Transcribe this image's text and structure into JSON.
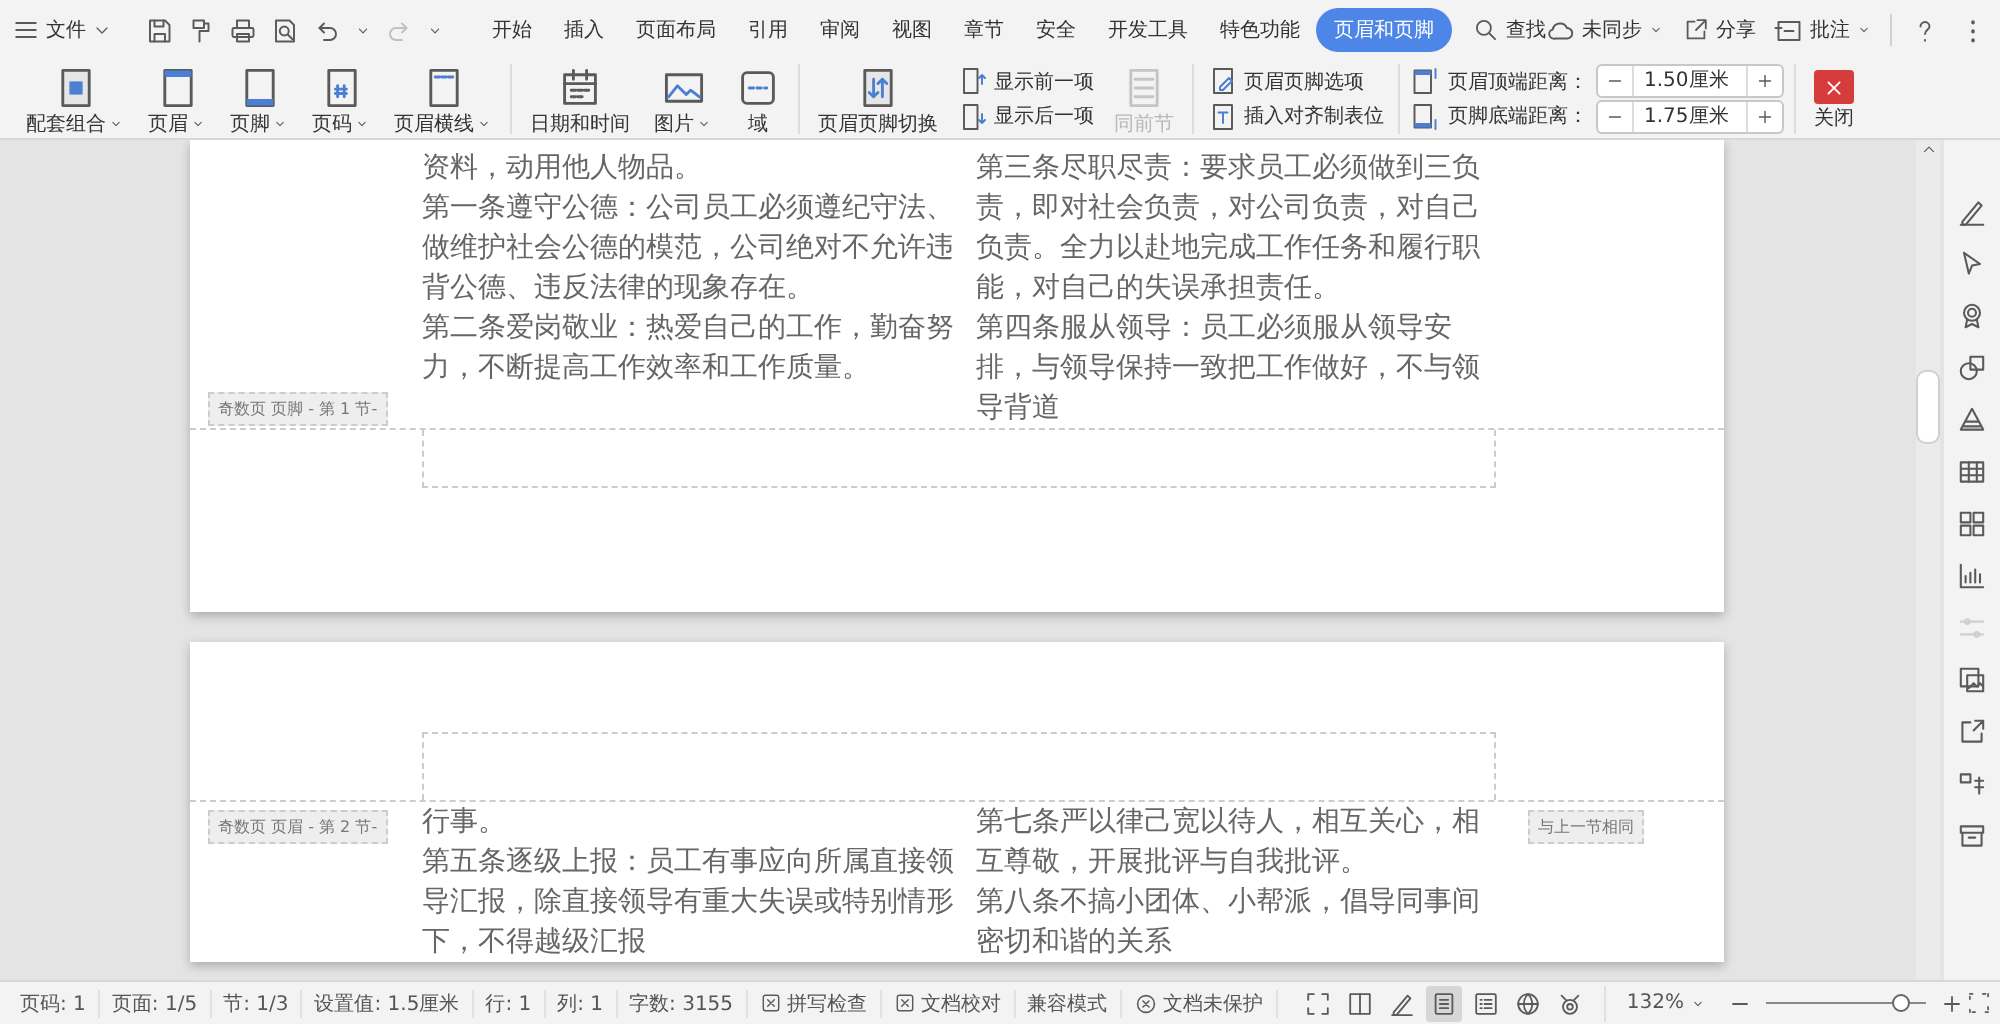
{
  "menu_bar": {
    "file_menu": "文件",
    "tabs": [
      {
        "label": "开始",
        "selected": false
      },
      {
        "label": "插入",
        "selected": false
      },
      {
        "label": "页面布局",
        "selected": false
      },
      {
        "label": "引用",
        "selected": false
      },
      {
        "label": "审阅",
        "selected": false
      },
      {
        "label": "视图",
        "selected": false
      },
      {
        "label": "章节",
        "selected": false
      },
      {
        "label": "安全",
        "selected": false
      },
      {
        "label": "开发工具",
        "selected": false
      },
      {
        "label": "特色功能",
        "selected": false
      },
      {
        "label": "页眉和页脚",
        "selected": true
      }
    ],
    "search": "查找",
    "sync": "未同步",
    "share": "分享",
    "comment": "批注"
  },
  "ribbon": {
    "groups": [
      {
        "items": [
          {
            "kind": "large",
            "label": "配套组合",
            "dropdown": true,
            "disabled": false
          },
          {
            "kind": "large",
            "label": "页眉",
            "dropdown": true,
            "disabled": false
          },
          {
            "kind": "large",
            "label": "页脚",
            "dropdown": true,
            "disabled": false
          },
          {
            "kind": "large",
            "label": "页码",
            "dropdown": true,
            "disabled": false
          },
          {
            "kind": "large",
            "label": "页眉横线",
            "dropdown": true,
            "disabled": false
          }
        ]
      },
      {
        "items": [
          {
            "kind": "large",
            "label": "日期和时间",
            "dropdown": false,
            "disabled": false
          },
          {
            "kind": "large",
            "label": "图片",
            "dropdown": true,
            "disabled": false
          },
          {
            "kind": "large",
            "label": "域",
            "dropdown": false,
            "disabled": false
          }
        ]
      },
      {
        "items": [
          {
            "kind": "large",
            "label": "页眉页脚切换",
            "dropdown": false,
            "disabled": false
          },
          {
            "kind": "small",
            "label": "显示前一项",
            "disabled": false
          },
          {
            "kind": "small",
            "label": "显示后一项",
            "disabled": false
          },
          {
            "kind": "large",
            "label": "同前节",
            "dropdown": false,
            "disabled": true
          }
        ]
      },
      {
        "items": [
          {
            "kind": "small",
            "label": "页眉页脚选项",
            "disabled": false
          },
          {
            "kind": "small",
            "label": "插入对齐制表位",
            "disabled": false
          }
        ]
      },
      {
        "items": [
          {
            "kind": "spinner",
            "label": "页眉顶端距离：",
            "value": "1.50厘米"
          },
          {
            "kind": "spinner",
            "label": "页脚底端距离：",
            "value": "1.75厘米"
          }
        ]
      },
      {
        "items": [
          {
            "kind": "close",
            "label": "关闭"
          }
        ]
      }
    ]
  },
  "document": {
    "pages": [
      {
        "body": {
          "left": [
            "资料，动用他人物品。",
            "第一条遵守公德：公司员工必须遵纪守法、做维护社会公德的模范，公司绝对不允许违背公德、违反法律的现象存在。",
            "第二条爱岗敬业：热爱自己的工作，勤奋努力，不断提高工作效率和工作质量。"
          ],
          "right": [
            "第三条尽职尽责：要求员工必须做到三负责，即对社会负责，对公司负责，对自己负责。全力以赴地完成工作任务和履行职能，对自己的失误承担责任。",
            "第四条服从领导：员工必须服从领导安排，与领导保持一致把工作做好，不与领导背道"
          ]
        },
        "footer": {
          "label": "奇数页 页脚 - 第 1 节-"
        }
      },
      {
        "header": {
          "label": "奇数页 页眉 - 第 2 节-",
          "link_label": "与上一节相同"
        },
        "body": {
          "left": [
            "行事。",
            "第五条逐级上报：员工有事应向所属直接领导汇报，除直接领导有重大失误或特别情形下，不得越级汇报"
          ],
          "right": [
            "第七条严以律己宽以待人，相互关心，相互尊敬，开展批评与自我批评。",
            "第八条不搞小团体、小帮派，倡导同事间密切和谐的关系"
          ]
        }
      }
    ]
  },
  "status_bar": {
    "items": [
      {
        "kind": "text",
        "label": "页码: 1"
      },
      {
        "kind": "text",
        "label": "页面: 1/5"
      },
      {
        "kind": "text",
        "label": "节: 1/3"
      },
      {
        "kind": "text",
        "label": "设置值: 1.5厘米"
      },
      {
        "kind": "text",
        "label": "行: 1"
      },
      {
        "kind": "text",
        "label": "列: 1"
      },
      {
        "kind": "text",
        "label": "字数: 3155"
      },
      {
        "kind": "toggle",
        "label": "拼写检查"
      },
      {
        "kind": "toggle",
        "label": "文档校对"
      },
      {
        "kind": "text",
        "label": "兼容模式"
      },
      {
        "kind": "protect",
        "label": "文档未保护"
      }
    ],
    "view_modes": [
      {
        "selected": false
      },
      {
        "selected": false
      },
      {
        "selected": false
      },
      {
        "selected": true
      },
      {
        "selected": false
      },
      {
        "selected": false
      },
      {
        "selected": false
      }
    ],
    "zoom": {
      "value": "132%",
      "level": 0.88
    }
  }
}
